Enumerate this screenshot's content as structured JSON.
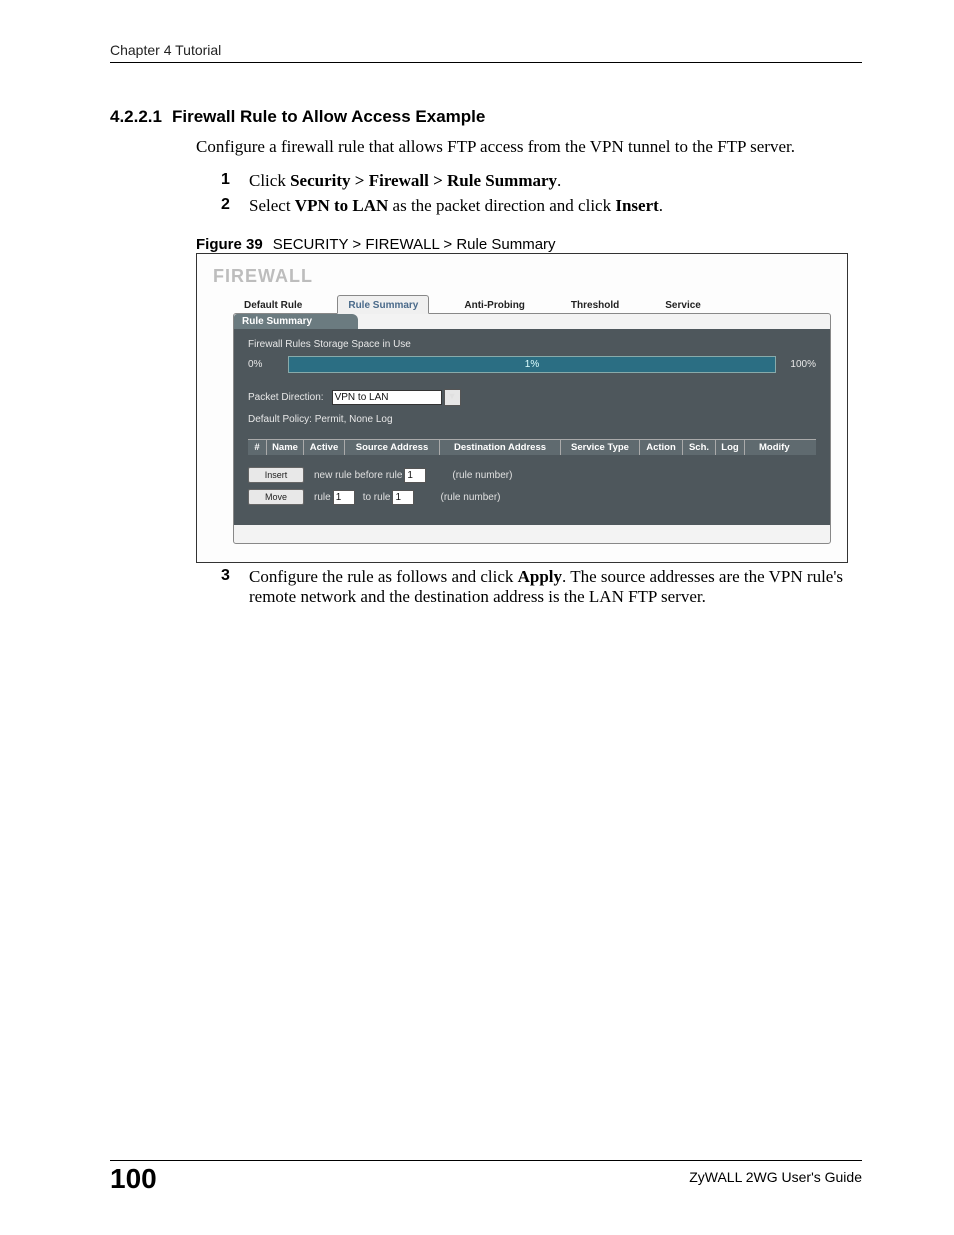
{
  "header": {
    "chapter": "Chapter 4 Tutorial"
  },
  "section": {
    "number": "4.2.2.1",
    "title": "Firewall Rule to Allow Access Example",
    "intro": "Configure a firewall rule that allows FTP access from the VPN tunnel to the FTP server."
  },
  "steps": {
    "s1num": "1",
    "s1_a": "Click ",
    "s1_b": "Security > Firewall > Rule Summary",
    "s1_c": ".",
    "s2num": "2",
    "s2_a": "Select ",
    "s2_b": "VPN to LAN",
    "s2_c": " as the packet direction and click ",
    "s2_d": "Insert",
    "s2_e": ".",
    "s3num": "3",
    "s3_a": "Configure the rule as follows and click ",
    "s3_b": "Apply",
    "s3_c": ". The source addresses are the VPN rule's remote network and the destination address is the LAN FTP server."
  },
  "figure": {
    "label": "Figure 39",
    "caption": "SECURITY > FIREWALL > Rule Summary"
  },
  "shot": {
    "title": "FIREWALL",
    "tabs": {
      "default_rule": "Default Rule",
      "rule_summary": "Rule Summary",
      "anti_probing": "Anti-Probing",
      "threshold": "Threshold",
      "service": "Service"
    },
    "segment_title": "Rule Summary",
    "storage_label": "Firewall Rules Storage Space in Use",
    "pct_left": "0%",
    "pct_mid": "1%",
    "pct_right": "100%",
    "direction_label": "Packet Direction:",
    "direction_value": "VPN to LAN",
    "default_policy": "Default Policy: Permit, None Log",
    "thead": {
      "num": "#",
      "name": "Name",
      "active": "Active",
      "src": "Source Address",
      "dst": "Destination Address",
      "svc": "Service Type",
      "action": "Action",
      "sch": "Sch.",
      "log": "Log",
      "modify": "Modify"
    },
    "insert_btn": "Insert",
    "insert_text1": "new rule before rule",
    "insert_val": "1",
    "rule_number_hint": "(rule number)",
    "move_btn": "Move",
    "move_text1": "rule",
    "move_val1": "1",
    "move_text2": "to rule",
    "move_val2": "1"
  },
  "footer": {
    "page": "100",
    "guide": "ZyWALL 2WG User's Guide"
  }
}
